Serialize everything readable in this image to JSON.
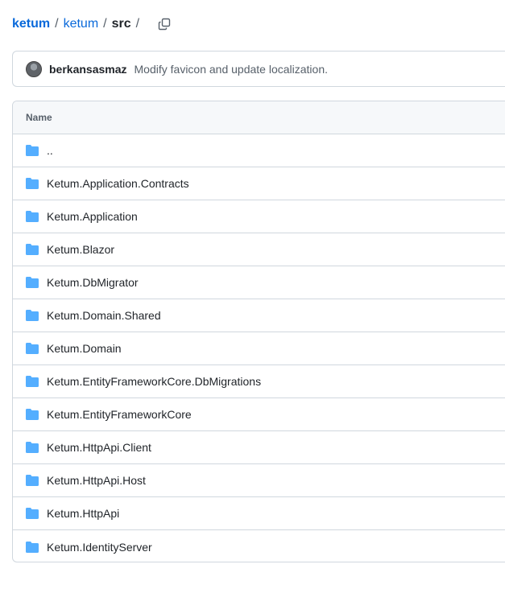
{
  "breadcrumb": {
    "owner": "ketum",
    "repo": "ketum",
    "current": "src",
    "separator": "/",
    "copy_icon": "copy-icon"
  },
  "commit": {
    "author": "berkansasmaz",
    "message": "Modify favicon and update localization.",
    "avatar_icon": "avatar"
  },
  "table": {
    "header": "Name",
    "folder_icon": "folder-icon",
    "folder_color": "#54aeff",
    "rows": [
      {
        "name": ".."
      },
      {
        "name": "Ketum.Application.Contracts"
      },
      {
        "name": "Ketum.Application"
      },
      {
        "name": "Ketum.Blazor"
      },
      {
        "name": "Ketum.DbMigrator"
      },
      {
        "name": "Ketum.Domain.Shared"
      },
      {
        "name": "Ketum.Domain"
      },
      {
        "name": "Ketum.EntityFrameworkCore.DbMigrations"
      },
      {
        "name": "Ketum.EntityFrameworkCore"
      },
      {
        "name": "Ketum.HttpApi.Client"
      },
      {
        "name": "Ketum.HttpApi.Host"
      },
      {
        "name": "Ketum.HttpApi"
      },
      {
        "name": "Ketum.IdentityServer"
      }
    ]
  },
  "colors": {
    "link": "#0969da",
    "border": "#d0d7de",
    "header_bg": "#f6f8fa",
    "muted": "#57606a"
  }
}
